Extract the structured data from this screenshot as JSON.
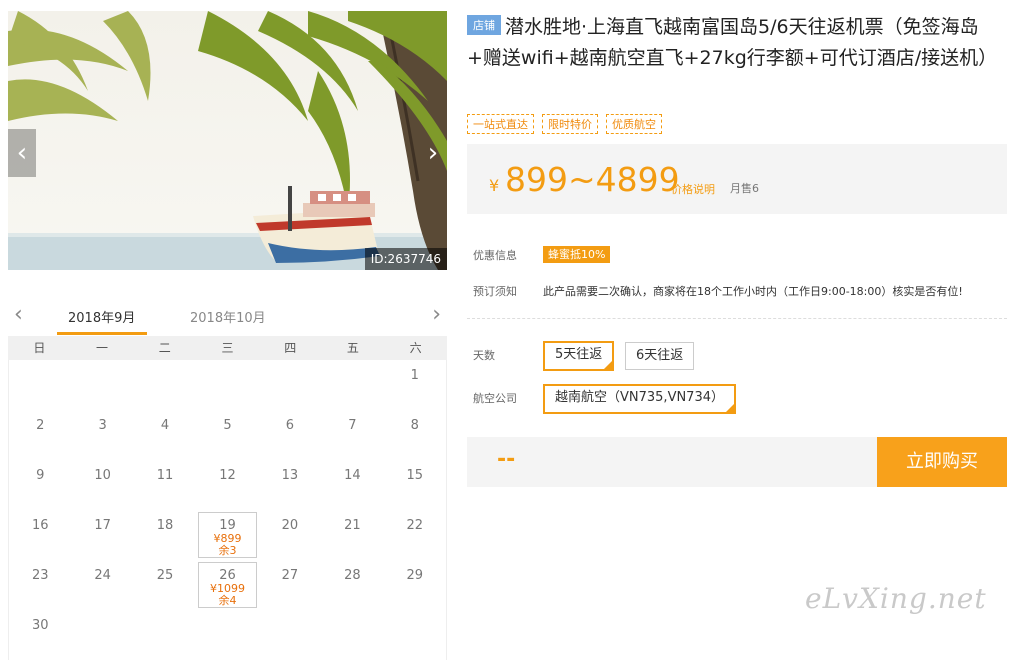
{
  "photo": {
    "id_label": "ID:2637746"
  },
  "calendar": {
    "tabs": [
      "2018年9月",
      "2018年10月"
    ],
    "weekdays": [
      "日",
      "一",
      "二",
      "三",
      "四",
      "五",
      "六"
    ],
    "days": [
      "",
      "",
      "",
      "",
      "",
      "",
      "1",
      "2",
      "3",
      "4",
      "5",
      "6",
      "7",
      "8",
      "9",
      "10",
      "11",
      "12",
      "13",
      "14",
      "15",
      "16",
      "17",
      "18",
      "19",
      "20",
      "21",
      "22",
      "23",
      "24",
      "25",
      "26",
      "27",
      "28",
      "29",
      "30",
      "",
      "",
      "",
      "",
      "",
      ""
    ],
    "prices": {
      "19": {
        "price": "¥899",
        "remain": "余3"
      },
      "26": {
        "price": "¥1099",
        "remain": "余4"
      }
    }
  },
  "product": {
    "shop_badge": "店铺",
    "title": "潜水胜地·上海直飞越南富国岛5/6天往返机票（免签海岛+赠送wifi+越南航空直飞+27kg行李额+可代订酒店/接送机）",
    "tags": [
      "一站式直达",
      "限时特价",
      "优质航空"
    ],
    "price": {
      "yen": "¥",
      "range": "899~4899",
      "note": "价格说明",
      "sold": "月售6"
    },
    "promo": {
      "label": "优惠信息",
      "value": "蜂蜜抵10%"
    },
    "booking": {
      "label": "预订须知",
      "value": "此产品需要二次确认，商家将在18个工作小时内（工作日9:00-18:00）核实是否有位!"
    },
    "days": {
      "label": "天数",
      "options": [
        "5天往返",
        "6天往返"
      ]
    },
    "airline": {
      "label": "航空公司",
      "option": "越南航空（VN735,VN734）"
    },
    "total": "--",
    "buy_label": "立即购买"
  },
  "watermark": "eLvXing.net",
  "colors": {
    "accent": "#f39c12",
    "badge": "#6fa6e0",
    "price_box": "#f4f4f4"
  }
}
